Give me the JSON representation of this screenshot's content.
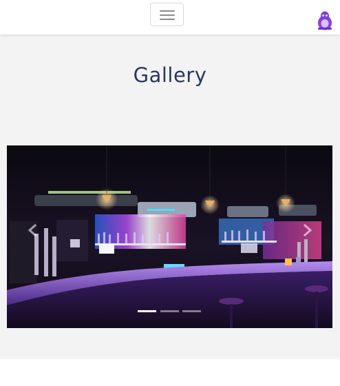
{
  "nav": {
    "toggle_icon": "hamburger-menu-icon",
    "logo_icon": "purple-mascot-logo-icon",
    "logo_color": "#7b3fd9"
  },
  "page": {
    "title": "Gallery",
    "title_color": "#2b3563",
    "background": "#f3f3f3"
  },
  "carousel": {
    "slide_image": "bar-interior-photo",
    "prev_icon": "chevron-left-icon",
    "next_icon": "chevron-right-icon",
    "slide_count": 3,
    "active_slide": 1
  }
}
